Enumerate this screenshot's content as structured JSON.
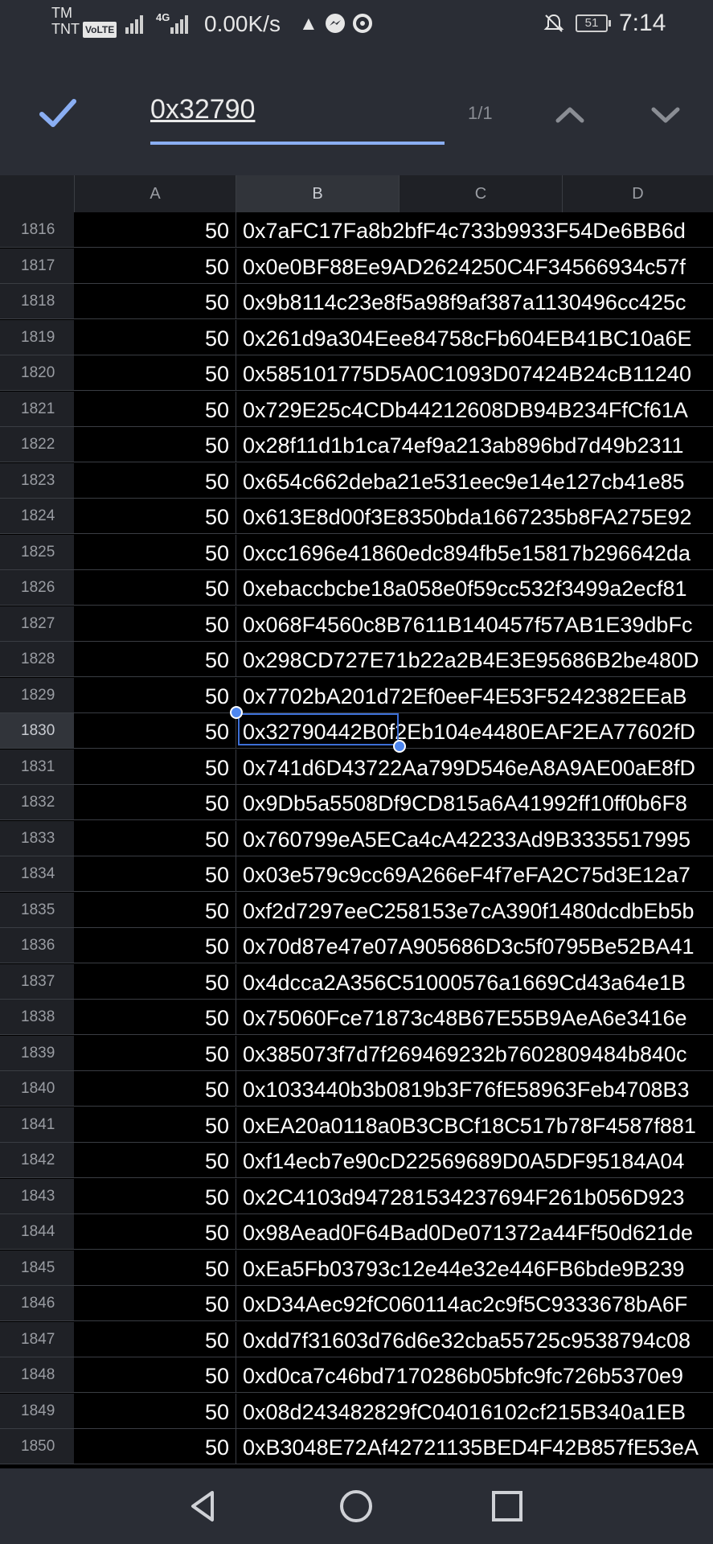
{
  "status_bar": {
    "carrier_tm": "TM",
    "carrier_name": "TNT",
    "volte": "VoLTE",
    "network_gen": "4G",
    "speed": "0.00K/s",
    "battery": "51",
    "time": "7:14",
    "icons": [
      "signal-icon",
      "cloud-upload-icon",
      "messenger-icon",
      "sync-icon",
      "bell-off-icon",
      "battery-icon"
    ]
  },
  "find_bar": {
    "search_value": "0x32790",
    "counter": "1/1",
    "accent_color": "#8aaef3",
    "icons": [
      "check-icon",
      "chevron-up-icon",
      "chevron-down-icon"
    ]
  },
  "columns": [
    "A",
    "B",
    "C",
    "D"
  ],
  "active_column": "B",
  "active_row": "1830",
  "rows": [
    {
      "num": "1816",
      "a": "50",
      "b": "0x7aFC17Fa8b2bfF4c733b9933F54De6BB6d"
    },
    {
      "num": "1817",
      "a": "50",
      "b": "0x0e0BF88Ee9AD2624250C4F34566934c57f"
    },
    {
      "num": "1818",
      "a": "50",
      "b": "0x9b8114c23e8f5a98f9af387a1130496cc425c"
    },
    {
      "num": "1819",
      "a": "50",
      "b": "0x261d9a304Eee84758cFb604EB41BC10a6E"
    },
    {
      "num": "1820",
      "a": "50",
      "b": "0x585101775D5A0C1093D07424B24cB11240"
    },
    {
      "num": "1821",
      "a": "50",
      "b": "0x729E25c4CDb44212608DB94B234FfCf61A"
    },
    {
      "num": "1822",
      "a": "50",
      "b": "0x28f11d1b1ca74ef9a213ab896bd7d49b2311"
    },
    {
      "num": "1823",
      "a": "50",
      "b": "0x654c662deba21e531eec9e14e127cb41e85"
    },
    {
      "num": "1824",
      "a": "50",
      "b": "0x613E8d00f3E8350bda1667235b8FA275E92"
    },
    {
      "num": "1825",
      "a": "50",
      "b": "0xcc1696e41860edc894fb5e15817b296642da"
    },
    {
      "num": "1826",
      "a": "50",
      "b": "0xebaccbcbe18a058e0f59cc532f3499a2ecf81"
    },
    {
      "num": "1827",
      "a": "50",
      "b": "0x068F4560c8B7611B140457f57AB1E39dbFc"
    },
    {
      "num": "1828",
      "a": "50",
      "b": "0x298CD727E71b22a2B4E3E95686B2be480D"
    },
    {
      "num": "1829",
      "a": "50",
      "b": "0x7702bA201d72Ef0eeF4E53F5242382EEaB"
    },
    {
      "num": "1830",
      "a": "50",
      "b": "0x32790442B0f2Eb104e4480EAF2EA77602fD"
    },
    {
      "num": "1831",
      "a": "50",
      "b": "0x741d6D43722Aa799D546eA8A9AE00aE8fD"
    },
    {
      "num": "1832",
      "a": "50",
      "b": "0x9Db5a5508Df9CD815a6A41992ff10ff0b6F8"
    },
    {
      "num": "1833",
      "a": "50",
      "b": "0x760799eA5ECa4cA42233Ad9B3335517995"
    },
    {
      "num": "1834",
      "a": "50",
      "b": "0x03e579c9cc69A266eF4f7eFA2C75d3E12a7"
    },
    {
      "num": "1835",
      "a": "50",
      "b": "0xf2d7297eeC258153e7cA390f1480dcdbEb5b"
    },
    {
      "num": "1836",
      "a": "50",
      "b": "0x70d87e47e07A905686D3c5f0795Be52BA41"
    },
    {
      "num": "1837",
      "a": "50",
      "b": "0x4dcca2A356C51000576a1669Cd43a64e1B"
    },
    {
      "num": "1838",
      "a": "50",
      "b": "0x75060Fce71873c48B67E55B9AeA6e3416e"
    },
    {
      "num": "1839",
      "a": "50",
      "b": "0x385073f7d7f269469232b7602809484b840c"
    },
    {
      "num": "1840",
      "a": "50",
      "b": "0x1033440b3b0819b3F76fE58963Feb4708B3"
    },
    {
      "num": "1841",
      "a": "50",
      "b": "0xEA20a0118a0B3CBCf18C517b78F4587f881"
    },
    {
      "num": "1842",
      "a": "50",
      "b": "0xf14ecb7e90cD22569689D0A5DF95184A04"
    },
    {
      "num": "1843",
      "a": "50",
      "b": "0x2C4103d947281534237694F261b056D923"
    },
    {
      "num": "1844",
      "a": "50",
      "b": "0x98Aead0F64Bad0De071372a44Ff50d621de"
    },
    {
      "num": "1845",
      "a": "50",
      "b": "0xEa5Fb03793c12e44e32e446FB6bde9B239"
    },
    {
      "num": "1846",
      "a": "50",
      "b": "0xD34Aec92fC060114ac2c9f5C9333678bA6F"
    },
    {
      "num": "1847",
      "a": "50",
      "b": "0xdd7f31603d76d6e32cba55725c9538794c08"
    },
    {
      "num": "1848",
      "a": "50",
      "b": "0xd0ca7c46bd7170286b05bfc9fc726b5370e9"
    },
    {
      "num": "1849",
      "a": "50",
      "b": "0x08d243482829fC04016102cf215B340a1EB"
    },
    {
      "num": "1850",
      "a": "50",
      "b": "0xB3048E72Af42721135BED4F42B857fE53eA"
    }
  ],
  "nav_bar": {
    "icons": [
      "back-icon",
      "home-icon",
      "recents-icon"
    ]
  }
}
